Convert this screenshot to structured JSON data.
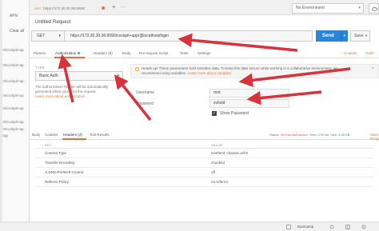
{
  "sidebar": {
    "apis": "APIs",
    "clear_all": "Clear all",
    "history": [
      ":9/cockpit+ap",
      ":9/cockpit+ap",
      ":9/cockpit+ap",
      ":9/cockpit+ap",
      ":9/cockpit+ap",
      ":9/cockpit+ap",
      ":9/cockpit+ap",
      "ogy"
    ]
  },
  "tab": {
    "method": "GET",
    "url": "https://172.30.30.36:9090/",
    "add": "+",
    "more": "···"
  },
  "environment": {
    "selected": "No Environment"
  },
  "request": {
    "title": "Untitled Request",
    "method": "GET",
    "url": "https://172.30.30.36:9090/cockpit+app/@localhost/login",
    "send_label": "Send",
    "save_label": "Save"
  },
  "subtabs": {
    "params": "Params",
    "authorization": "Authorization",
    "headers": "Headers (8)",
    "body": "Body",
    "prerequest": "Pre-request Script",
    "tests": "Tests",
    "settings": "Settings",
    "cookies": "Cookies",
    "code": "Code"
  },
  "auth": {
    "type_label": "TYPE",
    "type_value": "Basic Auth",
    "description": "The authorization header will be automatically generated when you send the request.",
    "learn_more": "Learn more about authorization",
    "headsup": "Heads up! These parameters hold sensitive data. To keep this data secure while working in a collaborative environment, we recommend using variables.",
    "headsup_link": "Learn more about variables",
    "username_label": "Username",
    "username_value": "root",
    "password_label": "Password",
    "password_value": "svbold",
    "show_password": "Show Password"
  },
  "response": {
    "tabs": {
      "body": "Body",
      "cookies": "Cookies",
      "headers": "Headers (4)",
      "test_results": "Test Results"
    },
    "status_label": "Status:",
    "status_value": "401 Not Authorized",
    "time_label": "Time:",
    "time_value": "178 ms",
    "size_label": "Size:",
    "size_value": "3.49 KB",
    "save_response": "Save Response",
    "col_key": "KEY",
    "col_value": "VALUE",
    "rows": [
      {
        "key": "Content-Type",
        "value": "text/html; charset=utf-8"
      },
      {
        "key": "Transfer-Encoding",
        "value": "chunked"
      },
      {
        "key": "X-DNS-Prefetch-Control",
        "value": "off"
      },
      {
        "key": "Referrer-Policy",
        "value": "no-referrer"
      }
    ]
  },
  "footer": {
    "bootcamp": "Bootcamp"
  },
  "colors": {
    "accent": "#f26b3a",
    "send": "#2a84d8",
    "arrow": "#d9323a"
  }
}
